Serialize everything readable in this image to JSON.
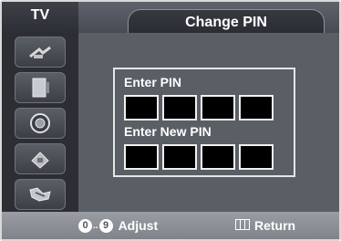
{
  "header": {
    "source_label": "TV",
    "title": "Change PIN"
  },
  "sidebar": {
    "items": [
      {
        "icon": "antenna-icon"
      },
      {
        "icon": "picture-icon"
      },
      {
        "icon": "sound-icon"
      },
      {
        "icon": "chip-icon"
      },
      {
        "icon": "setup-icon"
      }
    ]
  },
  "dialog": {
    "enter_pin_label": "Enter PIN",
    "enter_new_pin_label": "Enter New PIN",
    "pin_digits": [
      "",
      "",
      "",
      ""
    ],
    "new_pin_digits": [
      "",
      "",
      "",
      ""
    ]
  },
  "footer": {
    "adjust_key_start": "0",
    "adjust_key_end": "9",
    "adjust_label": "Adjust",
    "return_label": "Return"
  },
  "colors": {
    "background": "#4a4e56",
    "sidebar": "#2c2e33",
    "pin_box": "#000000",
    "footer": "#8c9096"
  }
}
